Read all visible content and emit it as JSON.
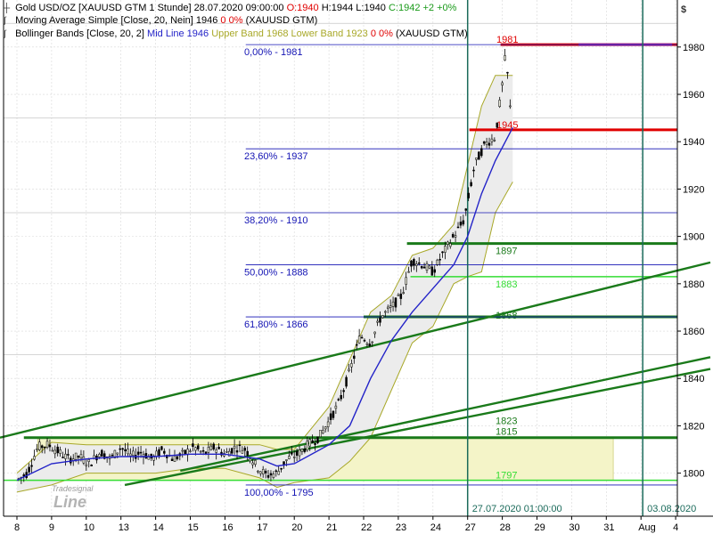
{
  "header": {
    "instrument": "Gold USD/OZ [XAUUSD GTM  1 Stunde] 28.07.2020 09:00:00",
    "ohlc_o": "O:1940",
    "ohlc_h": "H:1944",
    "ohlc_l": "L:1940",
    "ohlc_c": "C:1942 +2 +0%",
    "ma_label": "Moving Average Simple [Close, 20, Nein]",
    "ma_value": "1946",
    "ma_change": "0 0%",
    "ma_src": "(XAUUSD GTM)",
    "bb_label": "Bollinger Bands [Close, 20, 2]",
    "bb_mid": "Mid Line 1946",
    "bb_upper": "Upper Band 1968",
    "bb_lower": "Lower Band 1923",
    "bb_change": "0 0%",
    "bb_src": "(XAUUSD GTM)",
    "currency": "$"
  },
  "watermark": {
    "top": "Tradesignal",
    "bottom": "Line"
  },
  "colors": {
    "candle_body": "#e8e8d8",
    "candle_outline": "#000000",
    "ma": "#2323c8",
    "bb_band": "#a8a828",
    "bb_fill": "#ececec",
    "fib": "#1414b4",
    "support": "#1a7a1a",
    "support_light": "#33dd33",
    "resistance": "#e00000",
    "vline": "#1a6a5a",
    "purple": "#9a2a9a",
    "box": "#f4f4c8",
    "grid": "#d8d8d8"
  },
  "chart_data": {
    "type": "candlestick",
    "title": "Gold USD/OZ [XAUUSD GTM  1 Stunde]",
    "y_axis": {
      "min": 1784,
      "max": 1992,
      "ticks": [
        1800,
        1820,
        1840,
        1860,
        1880,
        1900,
        1920,
        1940,
        1960,
        1980
      ]
    },
    "x_axis_labels": [
      "8",
      "9",
      "10",
      "13",
      "14",
      "15",
      "16",
      "17",
      "20",
      "21",
      "22",
      "23",
      "24",
      "27",
      "28",
      "29",
      "30",
      "31",
      "Aug",
      "4"
    ],
    "fib_levels": [
      {
        "label": "0,00% - 1981",
        "value": 1981
      },
      {
        "label": "23,60% - 1937",
        "value": 1937
      },
      {
        "label": "38,20% - 1910",
        "value": 1910
      },
      {
        "label": "50,00% - 1888",
        "value": 1888
      },
      {
        "label": "61,80% - 1866",
        "value": 1866
      },
      {
        "label": "100,00% - 1795",
        "value": 1795
      }
    ],
    "horizontal_lines": [
      {
        "label": "1981",
        "value": 1981,
        "kind": "resistance"
      },
      {
        "label": "1945",
        "value": 1945,
        "kind": "resistance"
      },
      {
        "label": "1897",
        "value": 1897,
        "kind": "support"
      },
      {
        "label": "1883",
        "value": 1883,
        "kind": "support_light"
      },
      {
        "label": "1868",
        "value": 1866,
        "kind": "support"
      },
      {
        "label": "1823",
        "value": 1820,
        "kind": "support"
      },
      {
        "label": "1815",
        "value": 1815,
        "kind": "support"
      },
      {
        "label": "1797",
        "value": 1797,
        "kind": "support_light"
      }
    ],
    "trend_lines": [
      {
        "from": [
          0,
          1815
        ],
        "to": [
          20,
          1889
        ]
      },
      {
        "from": [
          3.6,
          1795
        ],
        "to": [
          20,
          1844
        ]
      },
      {
        "from": [
          5.2,
          1801
        ],
        "to": [
          20,
          1849
        ]
      }
    ],
    "vertical_markers": [
      {
        "label": "27.07.2020 01:00:00",
        "x": 13.0
      },
      {
        "label": "03.08.2020",
        "x": 18.05
      }
    ],
    "price_path": [
      [
        0,
        1797
      ],
      [
        0.3,
        1800
      ],
      [
        0.6,
        1811
      ],
      [
        0.9,
        1812
      ],
      [
        1.2,
        1809
      ],
      [
        1.5,
        1806
      ],
      [
        1.8,
        1807
      ],
      [
        2.1,
        1804
      ],
      [
        2.4,
        1809
      ],
      [
        2.7,
        1806
      ],
      [
        3.0,
        1811
      ],
      [
        3.3,
        1807
      ],
      [
        3.6,
        1809
      ],
      [
        3.9,
        1806
      ],
      [
        4.2,
        1810
      ],
      [
        4.5,
        1806
      ],
      [
        4.8,
        1808
      ],
      [
        5.1,
        1811
      ],
      [
        5.4,
        1808
      ],
      [
        5.7,
        1811
      ],
      [
        6.0,
        1808
      ],
      [
        6.3,
        1811
      ],
      [
        6.6,
        1810
      ],
      [
        6.9,
        1803
      ],
      [
        7.2,
        1799
      ],
      [
        7.5,
        1800
      ],
      [
        7.8,
        1806
      ],
      [
        8.1,
        1808
      ],
      [
        8.4,
        1812
      ],
      [
        8.7,
        1815
      ],
      [
        9.0,
        1822
      ],
      [
        9.3,
        1830
      ],
      [
        9.6,
        1843
      ],
      [
        9.9,
        1858
      ],
      [
        10.2,
        1855
      ],
      [
        10.5,
        1866
      ],
      [
        10.8,
        1870
      ],
      [
        11.1,
        1875
      ],
      [
        11.4,
        1890
      ],
      [
        11.7,
        1888
      ],
      [
        12.0,
        1885
      ],
      [
        12.3,
        1893
      ],
      [
        12.6,
        1900
      ],
      [
        12.9,
        1907
      ],
      [
        13.2,
        1930
      ],
      [
        13.5,
        1939
      ],
      [
        13.8,
        1942
      ],
      [
        14.0,
        1964
      ],
      [
        14.1,
        1978
      ],
      [
        14.3,
        1940
      ]
    ],
    "ma_path": [
      [
        0,
        1797
      ],
      [
        1.0,
        1804
      ],
      [
        2.0,
        1806
      ],
      [
        3.0,
        1807
      ],
      [
        4.0,
        1807
      ],
      [
        5.0,
        1808
      ],
      [
        6.0,
        1808
      ],
      [
        7.0,
        1806
      ],
      [
        7.5,
        1803
      ],
      [
        8.0,
        1804
      ],
      [
        9.0,
        1812
      ],
      [
        9.6,
        1820
      ],
      [
        10.2,
        1840
      ],
      [
        10.8,
        1856
      ],
      [
        11.4,
        1868
      ],
      [
        12.0,
        1878
      ],
      [
        12.6,
        1888
      ],
      [
        13.0,
        1900
      ],
      [
        13.4,
        1918
      ],
      [
        13.8,
        1932
      ],
      [
        14.3,
        1946
      ]
    ],
    "bb_upper": [
      [
        0,
        1800
      ],
      [
        1.0,
        1813
      ],
      [
        2.0,
        1812
      ],
      [
        3.0,
        1812
      ],
      [
        4.0,
        1812
      ],
      [
        5.0,
        1812
      ],
      [
        6.0,
        1812
      ],
      [
        7.0,
        1812
      ],
      [
        7.5,
        1810
      ],
      [
        8.0,
        1810
      ],
      [
        9.0,
        1828
      ],
      [
        9.6,
        1848
      ],
      [
        10.2,
        1868
      ],
      [
        10.8,
        1875
      ],
      [
        11.4,
        1892
      ],
      [
        12.0,
        1895
      ],
      [
        12.6,
        1905
      ],
      [
        13.0,
        1930
      ],
      [
        13.4,
        1955
      ],
      [
        13.8,
        1968
      ],
      [
        14.3,
        1968
      ]
    ],
    "bb_lower": [
      [
        0,
        1792
      ],
      [
        1.0,
        1795
      ],
      [
        2.0,
        1800
      ],
      [
        3.0,
        1800
      ],
      [
        4.0,
        1800
      ],
      [
        5.0,
        1802
      ],
      [
        6.0,
        1802
      ],
      [
        7.0,
        1798
      ],
      [
        7.5,
        1794
      ],
      [
        8.0,
        1796
      ],
      [
        9.0,
        1798
      ],
      [
        9.6,
        1805
      ],
      [
        10.2,
        1815
      ],
      [
        10.8,
        1835
      ],
      [
        11.4,
        1855
      ],
      [
        12.0,
        1862
      ],
      [
        12.6,
        1880
      ],
      [
        13.0,
        1883
      ],
      [
        13.4,
        1885
      ],
      [
        13.8,
        1910
      ],
      [
        14.3,
        1923
      ]
    ]
  }
}
